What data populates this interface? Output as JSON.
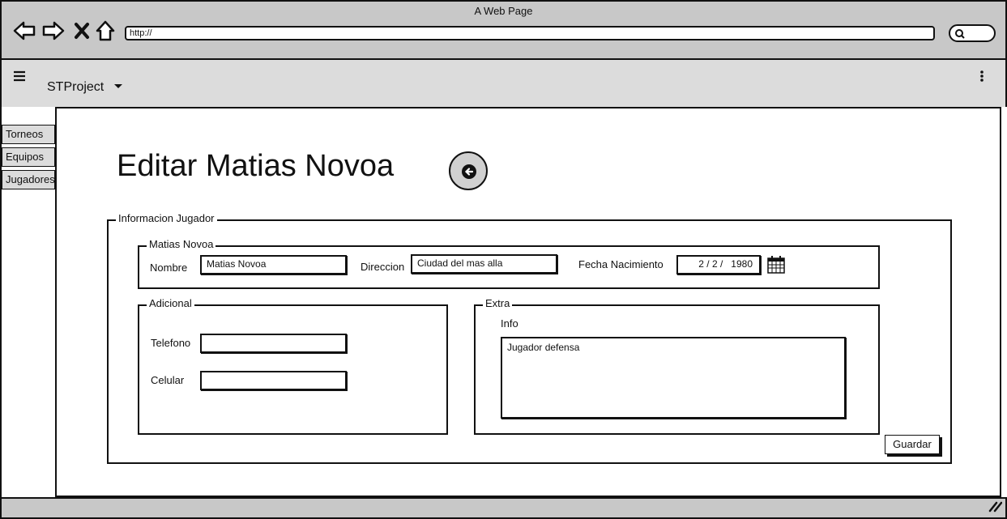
{
  "browser": {
    "title": "A Web Page",
    "url": "http://"
  },
  "app": {
    "project": "STProject",
    "menu_icon": "hamburger-icon",
    "more_icon": "kebab-icon"
  },
  "sidebar": {
    "items": [
      {
        "label": "Torneos"
      },
      {
        "label": "Equipos"
      },
      {
        "label": "Jugadores"
      }
    ]
  },
  "page": {
    "title": "Editar Matias Novoa"
  },
  "form": {
    "group_legend": "Informacion Jugador",
    "player": {
      "legend": "Matias Novoa",
      "nombre_label": "Nombre",
      "nombre_value": "Matias Novoa",
      "direccion_label": "Direccion",
      "direccion_value": "Ciudad del mas alla",
      "fecha_label": "Fecha Nacimiento",
      "fecha_value": "2 / 2 /   1980"
    },
    "adicional": {
      "legend": "Adicional",
      "telefono_label": "Telefono",
      "telefono_value": "",
      "celular_label": "Celular",
      "celular_value": ""
    },
    "extra": {
      "legend": "Extra",
      "info_label": "Info",
      "info_value": "Jugador defensa"
    },
    "save_label": "Guardar"
  }
}
